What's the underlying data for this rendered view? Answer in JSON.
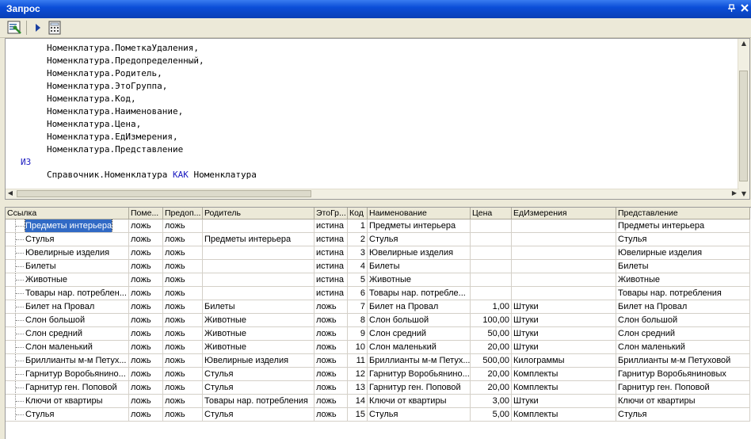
{
  "window": {
    "title": "Запрос"
  },
  "code_lines": [
    {
      "indent": true,
      "text": "Номенклатура.ПометкаУдаления,"
    },
    {
      "indent": true,
      "text": "Номенклатура.Предопределенный,"
    },
    {
      "indent": true,
      "text": "Номенклатура.Родитель,"
    },
    {
      "indent": true,
      "text": "Номенклатура.ЭтоГруппа,"
    },
    {
      "indent": true,
      "text": "Номенклатура.Код,"
    },
    {
      "indent": true,
      "text": "Номенклатура.Наименование,"
    },
    {
      "indent": true,
      "text": "Номенклатура.Цена,"
    },
    {
      "indent": true,
      "text": "Номенклатура.ЕдИзмерения,"
    },
    {
      "indent": true,
      "text": "Номенклатура.Представление"
    },
    {
      "indent": false,
      "text": "ИЗ",
      "keyword": true
    },
    {
      "indent": true,
      "text": "Справочник.Номенклатура ",
      "kw": "КАК",
      "tail": " Номенклатура"
    }
  ],
  "grid": {
    "columns": [
      "Ссылка",
      "Поме...",
      "Предоп...",
      "Родитель",
      "ЭтоГр...",
      "Код",
      "Наименование",
      "Цена",
      "ЕдИзмерения",
      "Представление"
    ],
    "rows": [
      [
        "Предметы интерьера",
        "ложь",
        "ложь",
        "",
        "истина",
        "1",
        "Предметы интерьера",
        "",
        "",
        "Предметы интерьера"
      ],
      [
        "Стулья",
        "ложь",
        "ложь",
        "Предметы интерьера",
        "истина",
        "2",
        "Стулья",
        "",
        "",
        "Стулья"
      ],
      [
        "Ювелирные изделия",
        "ложь",
        "ложь",
        "",
        "истина",
        "3",
        "Ювелирные изделия",
        "",
        "",
        "Ювелирные изделия"
      ],
      [
        "Билеты",
        "ложь",
        "ложь",
        "",
        "истина",
        "4",
        "Билеты",
        "",
        "",
        "Билеты"
      ],
      [
        "Животные",
        "ложь",
        "ложь",
        "",
        "истина",
        "5",
        "Животные",
        "",
        "",
        "Животные"
      ],
      [
        "Товары нар. потреблен...",
        "ложь",
        "ложь",
        "",
        "истина",
        "6",
        "Товары нар. потребле...",
        "",
        "",
        "Товары нар. потребления"
      ],
      [
        "Билет на Провал",
        "ложь",
        "ложь",
        "Билеты",
        "ложь",
        "7",
        "Билет на Провал",
        "1,00",
        "Штуки",
        "Билет на Провал"
      ],
      [
        "Слон большой",
        "ложь",
        "ложь",
        "Животные",
        "ложь",
        "8",
        "Слон большой",
        "100,00",
        "Штуки",
        "Слон большой"
      ],
      [
        "Слон средний",
        "ложь",
        "ложь",
        "Животные",
        "ложь",
        "9",
        "Слон средний",
        "50,00",
        "Штуки",
        "Слон средний"
      ],
      [
        "Слон маленький",
        "ложь",
        "ложь",
        "Животные",
        "ложь",
        "10",
        "Слон маленький",
        "20,00",
        "Штуки",
        "Слон маленький"
      ],
      [
        "Бриллианты м-м Петух...",
        "ложь",
        "ложь",
        "Ювелирные изделия",
        "ложь",
        "11",
        "Бриллианты м-м Петух...",
        "500,00",
        "Килограммы",
        "Бриллианты м-м Петуховой"
      ],
      [
        "Гарнитур Воробьянино...",
        "ложь",
        "ложь",
        "Стулья",
        "ложь",
        "12",
        "Гарнитур Воробьянино...",
        "20,00",
        "Комплекты",
        "Гарнитур Воробьяниновых"
      ],
      [
        "Гарнитур ген. Поповой",
        "ложь",
        "ложь",
        "Стулья",
        "ложь",
        "13",
        "Гарнитур ген. Поповой",
        "20,00",
        "Комплекты",
        "Гарнитур ген. Поповой"
      ],
      [
        "Ключи от квартиры",
        "ложь",
        "ложь",
        "Товары нар. потребления",
        "ложь",
        "14",
        "Ключи от квартиры",
        "3,00",
        "Штуки",
        "Ключи от квартиры"
      ],
      [
        "Стулья",
        "ложь",
        "ложь",
        "Стулья",
        "ложь",
        "15",
        "Стулья",
        "5,00",
        "Комплекты",
        "Стулья"
      ]
    ]
  },
  "icons": {
    "pin": "pin-icon",
    "close": "close-icon",
    "execute": "execute-query-icon",
    "run": "run-icon",
    "calc": "calculator-icon"
  },
  "colors": {
    "titlebar": "#0b4ed8",
    "selection": "#316ac5",
    "keyword": "#1a1ac0"
  }
}
